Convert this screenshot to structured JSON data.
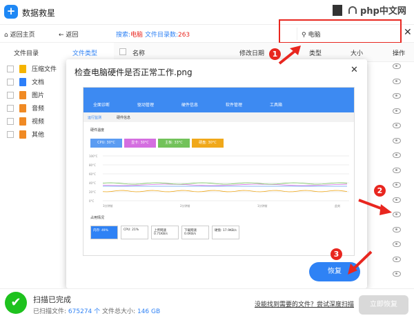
{
  "app": {
    "title": "数据救星",
    "logo": "+",
    "watermark": "php中文网"
  },
  "toolbar": {
    "home": "返回主页",
    "back": "返回",
    "search_label": "搜索:",
    "search_term": "电脑",
    "count_label": "文件目录数:",
    "count": "263",
    "search_value": "电脑"
  },
  "tabs": [
    "文件目录",
    "文件类型"
  ],
  "sidebar": [
    {
      "label": "压缩文件",
      "color": "#f5b400"
    },
    {
      "label": "文档",
      "color": "#2d7ff9"
    },
    {
      "label": "图片",
      "color": "#f08a24"
    },
    {
      "label": "音频",
      "color": "#f08a24"
    },
    {
      "label": "视频",
      "color": "#f08a24"
    },
    {
      "label": "其他",
      "color": "#f08a24"
    }
  ],
  "columns": [
    "名称",
    "修改日期",
    "类型",
    "大小",
    "操作"
  ],
  "modal": {
    "title": "检查电脑硬件是否正常工作.png",
    "restore": "恢复",
    "preview": {
      "nav": [
        "全面诊断",
        "驱动管理",
        "硬件信息",
        "软件管理",
        "工具箱"
      ],
      "subtabs": [
        "运行监测",
        "硬件信息"
      ],
      "section1": "硬件温度",
      "temps": [
        {
          "label": "CPU: 30°C",
          "color": "#5b9cf2"
        },
        {
          "label": "显卡: 30°C",
          "color": "#d46ee0"
        },
        {
          "label": "主板: 33°C",
          "color": "#72c25a"
        },
        {
          "label": "硬盘: 30°C",
          "color": "#f0a81a"
        }
      ],
      "yticks": [
        "100°C",
        "80°C",
        "60°C",
        "40°C",
        "20°C",
        "0°C"
      ],
      "xticks": [
        "3分钟前",
        "2分钟前",
        "1分钟前",
        "此刻"
      ],
      "section2": "占用情况",
      "usage": [
        "内存: 49%",
        "CPU: 21%",
        "上传网速 0.71KB/s",
        "下载网速 0.0KB/s",
        "硬盘: 17.9KB/s"
      ]
    }
  },
  "annotations": [
    "1",
    "2",
    "3"
  ],
  "footer": {
    "status": "扫描已完成",
    "scanned_label": "已扫描文件:",
    "scanned": "675274 个",
    "size_label": "文件总大小:",
    "size": "146 GB",
    "deep_link": "没能找到需要的文件？尝试深度扫描",
    "restore_now": "立即恢复"
  },
  "colors": {
    "accent": "#2f82f5",
    "red": "#e8261f",
    "green": "#1ec21e"
  }
}
